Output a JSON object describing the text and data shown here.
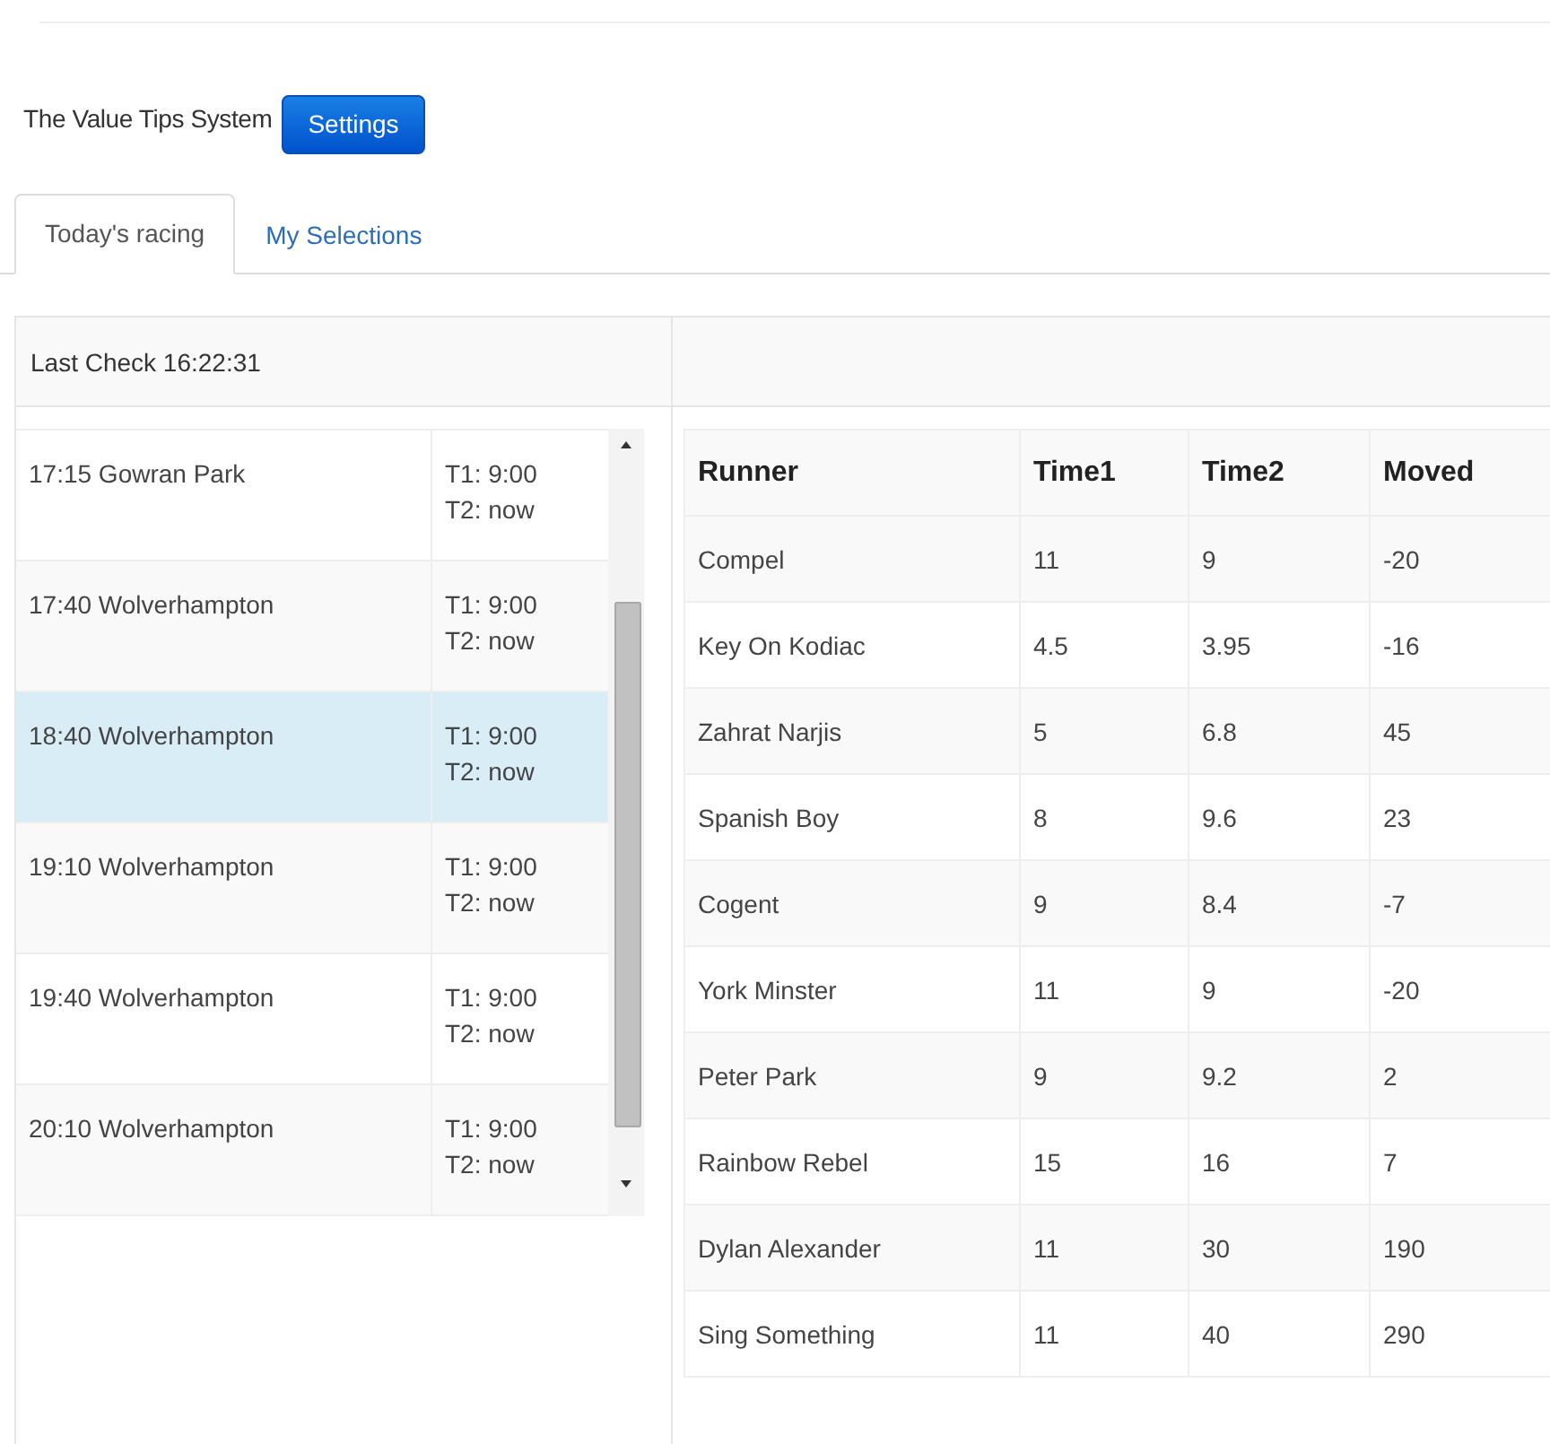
{
  "header": {
    "title": "The Value Tips System",
    "settings_button": "Settings"
  },
  "tabs": [
    {
      "label": "Today's racing",
      "selected": true
    },
    {
      "label": "My Selections",
      "selected": false
    }
  ],
  "status": "Last Check 16:22:31",
  "races": [
    {
      "name": "17:15 Gowran Park",
      "t1": "T1: 9:00",
      "t2": "T2: now",
      "selected": false
    },
    {
      "name": "17:40 Wolverhampton",
      "t1": "T1: 9:00",
      "t2": "T2: now",
      "selected": false
    },
    {
      "name": "18:40 Wolverhampton",
      "t1": "T1: 9:00",
      "t2": "T2: now",
      "selected": true
    },
    {
      "name": "19:10 Wolverhampton",
      "t1": "T1: 9:00",
      "t2": "T2: now",
      "selected": false
    },
    {
      "name": "19:40 Wolverhampton",
      "t1": "T1: 9:00",
      "t2": "T2: now",
      "selected": false
    },
    {
      "name": "20:10 Wolverhampton",
      "t1": "T1: 9:00",
      "t2": "T2: now",
      "selected": false
    }
  ],
  "runners_table": {
    "columns": [
      "Runner",
      "Time1",
      "Time2",
      "Moved"
    ],
    "rows": [
      [
        "Compel",
        "11",
        "9",
        "-20"
      ],
      [
        "Key On Kodiac",
        "4.5",
        "3.95",
        "-16"
      ],
      [
        "Zahrat Narjis",
        "5",
        "6.8",
        "45"
      ],
      [
        "Spanish Boy",
        "8",
        "9.6",
        "23"
      ],
      [
        "Cogent",
        "9",
        "8.4",
        "-7"
      ],
      [
        "York Minster",
        "11",
        "9",
        "-20"
      ],
      [
        "Peter Park",
        "9",
        "9.2",
        "2"
      ],
      [
        "Rainbow Rebel",
        "15",
        "16",
        "7"
      ],
      [
        "Dylan Alexander",
        "11",
        "30",
        "190"
      ],
      [
        "Sing Something",
        "11",
        "40",
        "290"
      ]
    ]
  }
}
